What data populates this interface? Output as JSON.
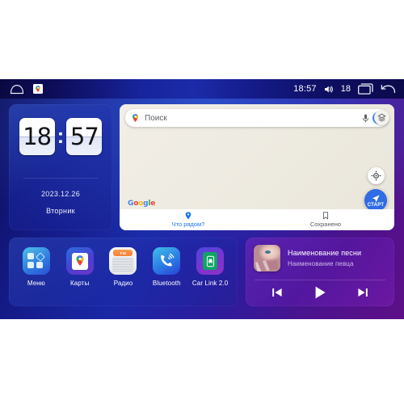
{
  "statusbar": {
    "home_icon": "home-icon",
    "maps_icon": "maps-pin-icon",
    "time": "18:57",
    "volume_icon": "speaker-icon",
    "volume_level": "18",
    "recents_icon": "recent-apps-icon",
    "back_icon": "back-arrow-icon"
  },
  "clock_widget": {
    "hours": "18",
    "minutes": "57",
    "separator": ":",
    "date": "2023.12.26",
    "weekday": "Вторник"
  },
  "maps_widget": {
    "search_placeholder": "Поиск",
    "pin_icon": "maps-pin-icon",
    "mic_icon": "microphone-icon",
    "account_icon": "account-avatar-icon",
    "layers_icon": "layers-icon",
    "google_logo": [
      "G",
      "o",
      "o",
      "g",
      "l",
      "e"
    ],
    "locate_icon": "my-location-icon",
    "start_icon": "navigation-arrow-icon",
    "start_label": "СТАРТ",
    "tabs": [
      {
        "label": "Что рядом?",
        "icon": "place-pin-icon",
        "active": true
      },
      {
        "label": "Сохранено",
        "icon": "bookmark-icon",
        "active": false
      }
    ]
  },
  "apps": [
    {
      "label": "Меню",
      "icon": "app-grid-icon"
    },
    {
      "label": "Карты",
      "icon": "maps-pin-icon"
    },
    {
      "label": "Радио",
      "icon": "fm-radio-icon"
    },
    {
      "label": "Bluetooth",
      "icon": "bluetooth-phone-icon"
    },
    {
      "label": "Car Link 2.0",
      "icon": "car-link-phone-icon"
    }
  ],
  "music_widget": {
    "album_art": "album-art-portrait",
    "title": "Наименование песни",
    "artist": "Наименование певца",
    "prev_icon": "previous-track-icon",
    "play_icon": "play-icon",
    "next_icon": "next-track-icon"
  },
  "colors": {
    "accent_blue": "#2f6ce5",
    "map_bg": "#efece3",
    "music_purple": "#7628be",
    "radio_orange": "#f5803a",
    "carlink_green": "#10a363"
  }
}
